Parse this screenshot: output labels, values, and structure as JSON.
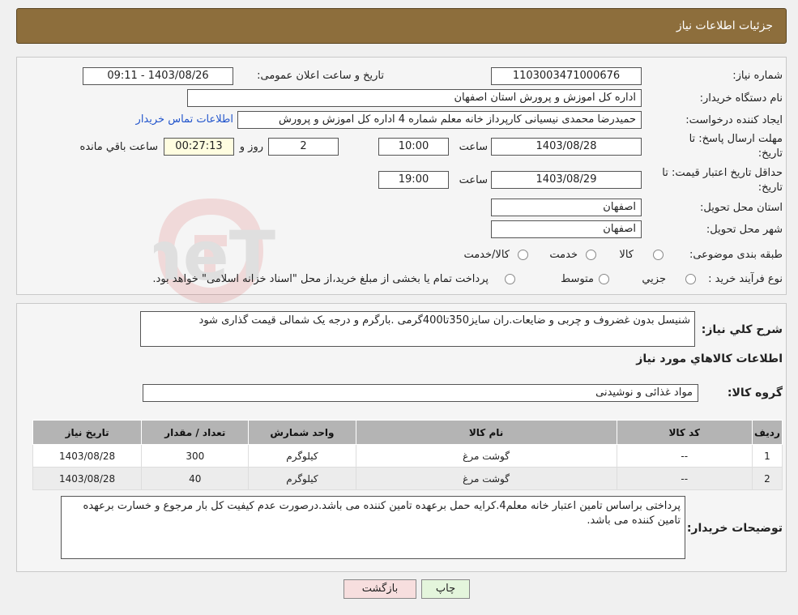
{
  "header": {
    "title": "جزئیات اطلاعات نیاز"
  },
  "form": {
    "need_number": {
      "label": "شماره نیاز:",
      "value": "1103003471000676"
    },
    "announce_datetime": {
      "label": "تاریخ و ساعت اعلان عمومی:",
      "value": "1403/08/26 - 09:11"
    },
    "buyer_org": {
      "label": "نام دستگاه خریدار:",
      "value": "اداره کل اموزش و پرورش استان اصفهان"
    },
    "requester": {
      "label": "ایجاد کننده درخواست:",
      "value": "حمیدرضا محمدی نیسیانی کارپرداز خانه معلم شماره 4 اداره کل اموزش و پرورش",
      "contact_link": "اطلاعات تماس خریدار"
    },
    "response_deadline": {
      "label_line1": "مهلت ارسال پاسخ: تا",
      "label_line2": "تاریخ:",
      "date": "1403/08/28",
      "time_label": "ساعت",
      "time": "10:00",
      "days": "2",
      "days_label": "روز و",
      "remaining": "00:27:13",
      "remaining_label": "ساعت باقي مانده"
    },
    "price_validity": {
      "label_line1": "حداقل تاریخ اعتبار قیمت: تا",
      "label_line2": "تاریخ:",
      "date": "1403/08/29",
      "time_label": "ساعت",
      "time": "19:00"
    },
    "delivery_province": {
      "label": "استان محل تحویل:",
      "value": "اصفهان"
    },
    "delivery_city": {
      "label": "شهر محل تحویل:",
      "value": "اصفهان"
    },
    "category": {
      "label": "طبقه بندی موضوعی:",
      "options": [
        "کالا",
        "خدمت",
        "کالا/خدمت"
      ]
    },
    "purchase_process": {
      "label": "نوع فرآیند خرید :",
      "options": [
        "جزیي",
        "متوسط"
      ],
      "note": "پرداخت تمام یا بخشی از مبلغ خرید،از محل \"اسناد خزانه اسلامی\" خواهد بود."
    }
  },
  "description": {
    "label": "شرح کلي نياز:",
    "value": "شنیسل بدون غضروف و چربی و ضایعات.ران سایز350تا400گرمی .بارگرم و درجه یک شمالی قیمت گذاری شود"
  },
  "items_section": {
    "title": "اطلاعات کالاهاي مورد نياز",
    "group_label": "گروه کالا:",
    "group_value": "مواد غذائی و نوشیدنی",
    "columns": [
      "رديف",
      "کد کالا",
      "نام کالا",
      "واحد شمارش",
      "تعداد / مقدار",
      "تاريخ نياز"
    ],
    "rows": [
      [
        "1",
        "--",
        "گوشت مرغ",
        "کیلوگرم",
        "300",
        "1403/08/28"
      ],
      [
        "2",
        "--",
        "گوشت مرغ",
        "کیلوگرم",
        "40",
        "1403/08/28"
      ]
    ]
  },
  "buyer_notes": {
    "label": "توضیحات خریدار:",
    "value": "پرداختی براساس تامین اعتبار خانه معلم4.کرایه حمل برعهده تامین کننده می باشد.درصورت عدم کیفیت کل بار مرجوع و خسارت برعهده تامین کننده می باشد."
  },
  "buttons": {
    "print": "چاپ",
    "back": "بازگشت"
  },
  "watermark": {
    "text": "AriaTender.neT"
  },
  "colors": {
    "header": "#8d6e3c",
    "print_button": "#e4f5dc",
    "back_button": "#f7dede",
    "link": "#2255cc"
  }
}
